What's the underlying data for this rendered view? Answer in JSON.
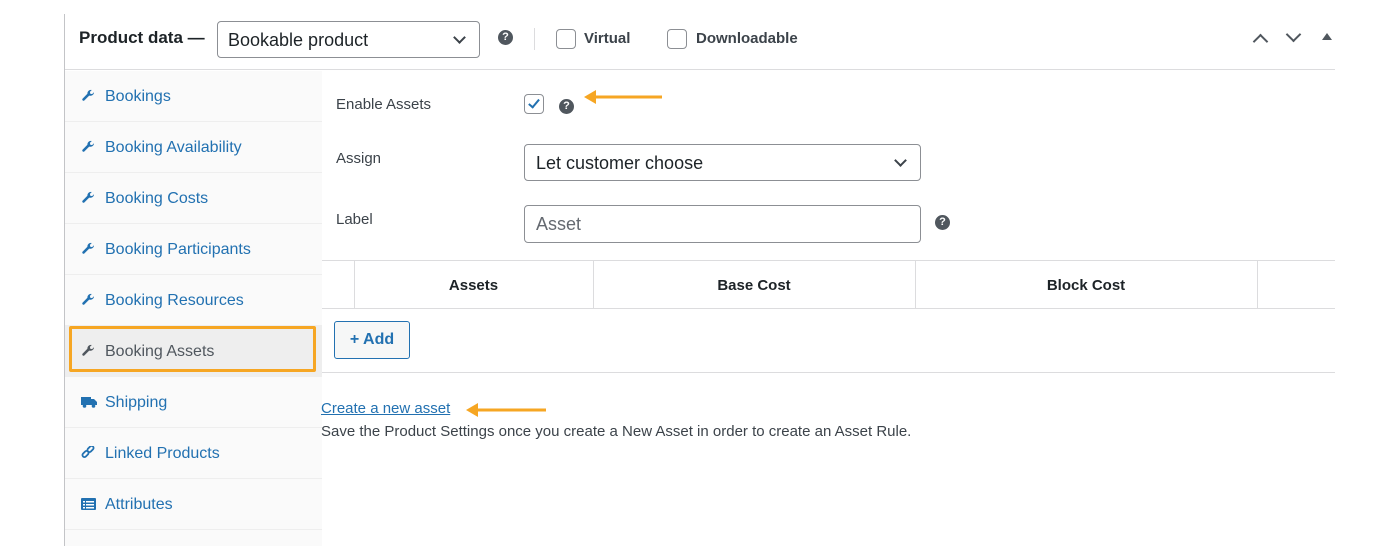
{
  "header": {
    "title": "Product data —",
    "product_type": "Bookable product",
    "virtual_label": "Virtual",
    "downloadable_label": "Downloadable",
    "help_glyph": "?"
  },
  "sidebar": {
    "items": [
      {
        "label": "Bookings",
        "icon": "wrench-icon"
      },
      {
        "label": "Booking Availability",
        "icon": "wrench-icon"
      },
      {
        "label": "Booking Costs",
        "icon": "wrench-icon"
      },
      {
        "label": "Booking Participants",
        "icon": "wrench-icon"
      },
      {
        "label": "Booking Resources",
        "icon": "wrench-icon"
      },
      {
        "label": "Booking Assets",
        "icon": "wrench-icon",
        "active": true
      },
      {
        "label": "Shipping",
        "icon": "truck-icon"
      },
      {
        "label": "Linked Products",
        "icon": "link-icon"
      },
      {
        "label": "Attributes",
        "icon": "list-icon"
      }
    ]
  },
  "form": {
    "enable_assets_label": "Enable Assets",
    "enable_assets_checked": true,
    "assign_label": "Assign",
    "assign_value": "Let customer choose",
    "label_label": "Label",
    "label_placeholder": "Asset"
  },
  "table": {
    "headers": [
      "Assets",
      "Base Cost",
      "Block Cost"
    ]
  },
  "add_button": "+ Add",
  "create_link": "Create a new asset",
  "save_note": "Save the Product Settings once you create a New Asset in order to create an Asset Rule.",
  "colors": {
    "accent": "#2271b1",
    "highlight": "#f6a623",
    "text": "#3c434a"
  }
}
